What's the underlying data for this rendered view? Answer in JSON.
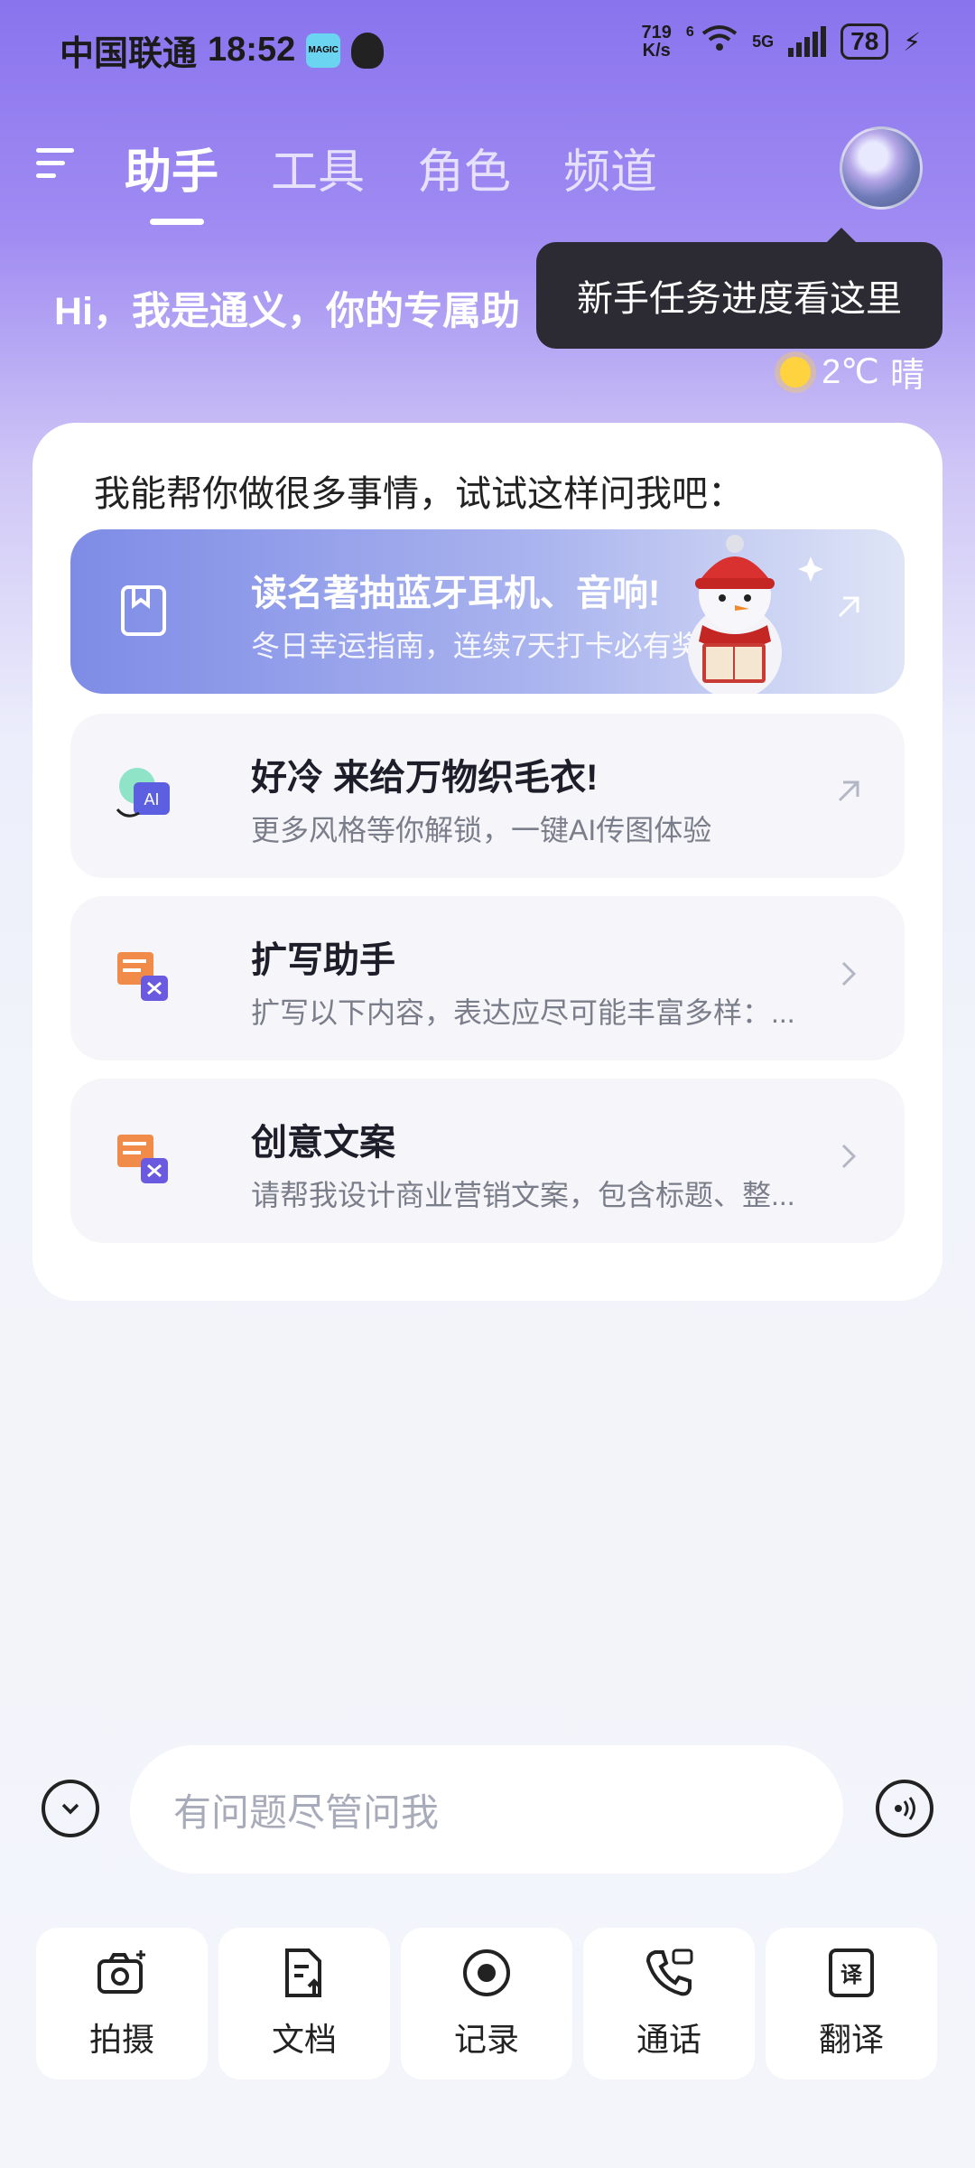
{
  "status_bar": {
    "carrier": "中国联通",
    "time": "18:52",
    "app_badge": "MAGIC",
    "speed_value": "719",
    "speed_unit": "K/s",
    "wifi_label": "6",
    "network": "5G",
    "battery": "78"
  },
  "nav": {
    "tabs": [
      {
        "label": "助手",
        "active": true
      },
      {
        "label": "工具",
        "active": false
      },
      {
        "label": "角色",
        "active": false
      },
      {
        "label": "频道",
        "active": false
      }
    ]
  },
  "greeting": "Hi，我是通义，你的专属助",
  "tooltip": "新手任务进度看这里",
  "weather": {
    "temp": "2℃",
    "condition": "晴",
    "icon": "sun-icon"
  },
  "card": {
    "title": "我能帮你做很多事情，试试这样问我吧：",
    "items": [
      {
        "title": "读名著抽蓝牙耳机、音响!",
        "subtitle": "冬日幸运指南，连续7天打卡必有奖",
        "icon": "bookmark-icon",
        "arrow": "arrow-up-right-icon"
      },
      {
        "title": "好冷 来给万物织毛衣!",
        "subtitle": "更多风格等你解锁，一键AI传图体验",
        "icon": "ai-image-icon",
        "icon_text": "AI",
        "arrow": "arrow-up-right-icon"
      },
      {
        "title": "扩写助手",
        "subtitle": "扩写以下内容，表达应尽可能丰富多样：...",
        "icon": "expand-writing-icon",
        "arrow": "chevron-right-icon"
      },
      {
        "title": "创意文案",
        "subtitle": "请帮我设计商业营销文案，包含标题、整...",
        "icon": "copywriting-icon",
        "arrow": "chevron-right-icon"
      }
    ]
  },
  "input": {
    "placeholder": "有问题尽管问我"
  },
  "tools": [
    {
      "label": "拍摄",
      "icon": "camera-icon"
    },
    {
      "label": "文档",
      "icon": "document-upload-icon"
    },
    {
      "label": "记录",
      "icon": "record-icon"
    },
    {
      "label": "通话",
      "icon": "phone-call-icon"
    },
    {
      "label": "翻译",
      "icon": "translate-icon",
      "icon_text": "译"
    }
  ],
  "colors": {
    "accent": "#8a74ee",
    "tooltip_bg": "#2c2a33",
    "promo": "#7e8ce6"
  }
}
